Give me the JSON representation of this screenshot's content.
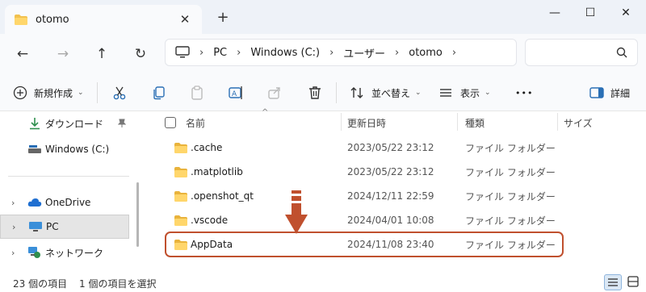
{
  "window": {
    "tab_title": "otomo",
    "tab_close": "✕",
    "new_tab": "+",
    "minimize": "—",
    "maximize": "☐",
    "close": "✕"
  },
  "nav": {
    "back": "←",
    "forward": "→",
    "up": "↑",
    "refresh": "↻",
    "breadcrumb": [
      "PC",
      "Windows (C:)",
      "ユーザー",
      "otomo"
    ],
    "breadcrumb_sep": "›"
  },
  "toolbar": {
    "new_label": "新規作成",
    "sort_label": "並べ替え",
    "view_label": "表示",
    "more_label": "•••",
    "details_label": "詳細",
    "chevron": "⌄"
  },
  "sidebar": {
    "items": [
      {
        "label": "ダウンロード",
        "icon": "download-icon"
      },
      {
        "label": "Windows (C:)",
        "icon": "drive-icon"
      },
      {
        "label": "OneDrive",
        "icon": "cloud-icon"
      },
      {
        "label": "PC",
        "icon": "computer-icon"
      },
      {
        "label": "ネットワーク",
        "icon": "network-icon"
      }
    ],
    "chevron": "›"
  },
  "columns": {
    "name": "名前",
    "date": "更新日時",
    "type": "種類",
    "size": "サイズ"
  },
  "files": [
    {
      "name": ".cache",
      "date": "2023/05/22 23:12",
      "type": "ファイル フォルダー"
    },
    {
      "name": ".matplotlib",
      "date": "2023/05/22 23:12",
      "type": "ファイル フォルダー"
    },
    {
      "name": ".openshot_qt",
      "date": "2024/12/11 22:59",
      "type": "ファイル フォルダー"
    },
    {
      "name": ".vscode",
      "date": "2024/04/01 10:08",
      "type": "ファイル フォルダー"
    },
    {
      "name": "AppData",
      "date": "2024/11/08 23:40",
      "type": "ファイル フォルダー"
    }
  ],
  "status": {
    "count": "23 個の項目",
    "selection": "1 個の項目を選択"
  },
  "colors": {
    "accent_highlight": "#c0502e",
    "folder": "#f2c14e",
    "titlebar_bg": "#eef2f8"
  }
}
